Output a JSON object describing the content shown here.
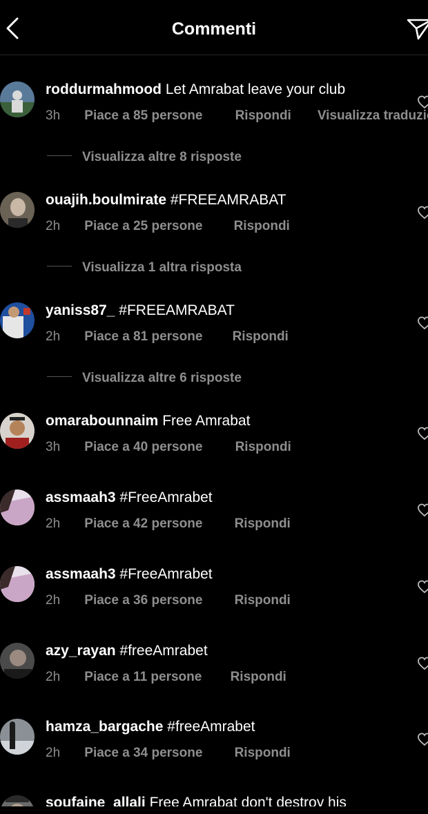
{
  "header": {
    "title": "Commenti",
    "back_icon": "chevron-left-icon",
    "send_icon": "paper-plane-icon"
  },
  "comments": [
    {
      "username": "roddurmahmood",
      "text": "Let Amrabat leave your club",
      "time": "3h",
      "likes": "Piace a 85 persone",
      "reply": "Rispondi",
      "translate": "Visualizza traduzio",
      "replies_link": "Visualizza altre 8 risposte",
      "avatar_colors": [
        "#5a7a9a",
        "#d9d9d9",
        "#3a5f3a"
      ]
    },
    {
      "username": "ouajih.boulmirate",
      "text": "#FREEAMRABAT",
      "time": "2h",
      "likes": "Piace a 25 persone",
      "reply": "Rispondi",
      "replies_link": "Visualizza 1 altra risposta",
      "avatar_colors": [
        "#6b6256",
        "#c9b8a6",
        "#2a2a2a"
      ]
    },
    {
      "username": "yaniss87_",
      "text": "#FREEAMRABAT",
      "time": "2h",
      "likes": "Piace a 81 persone",
      "reply": "Rispondi",
      "replies_link": "Visualizza altre 6 risposte",
      "avatar_colors": [
        "#1f4f9f",
        "#e6e6e6",
        "#c0392b"
      ]
    },
    {
      "username": "omarabounnaim",
      "text": "Free Amrabat",
      "time": "3h",
      "likes": "Piace a 40 persone",
      "reply": "Rispondi",
      "avatar_colors": [
        "#d7d2cc",
        "#b5835a",
        "#a02020"
      ]
    },
    {
      "username": "assmaah3",
      "text": "#FreeAmrabet",
      "time": "2h",
      "likes": "Piace a 42 persone",
      "reply": "Rispondi",
      "avatar_colors": [
        "#e8e0ea",
        "#caa6c6",
        "#3a2a2a"
      ]
    },
    {
      "username": "assmaah3",
      "text": "#FreeAmrabet",
      "time": "2h",
      "likes": "Piace a 36 persone",
      "reply": "Rispondi",
      "avatar_colors": [
        "#e8e0ea",
        "#caa6c6",
        "#3a2a2a"
      ]
    },
    {
      "username": "azy_rayan",
      "text": "#freeAmrabet",
      "time": "2h",
      "likes": "Piace a 11 persone",
      "reply": "Rispondi",
      "avatar_colors": [
        "#4a4a4a",
        "#9a8a80",
        "#1a1a1a"
      ]
    },
    {
      "username": "hamza_bargache",
      "text": "#freeAmrabet",
      "time": "2h",
      "likes": "Piace a 34 persone",
      "reply": "Rispondi",
      "avatar_colors": [
        "#8a9096",
        "#d0d4d8",
        "#1a1a1a"
      ]
    },
    {
      "username": "soufaine_allali",
      "text": "Free Amrabat don't destroy his",
      "avatar_colors": [
        "#6a6a6a",
        "#b0a090",
        "#2a2a2a"
      ]
    }
  ],
  "colors": {
    "background": "#000000",
    "text": "#ffffff",
    "meta": "#8e8e8e",
    "divider": "#262626"
  }
}
